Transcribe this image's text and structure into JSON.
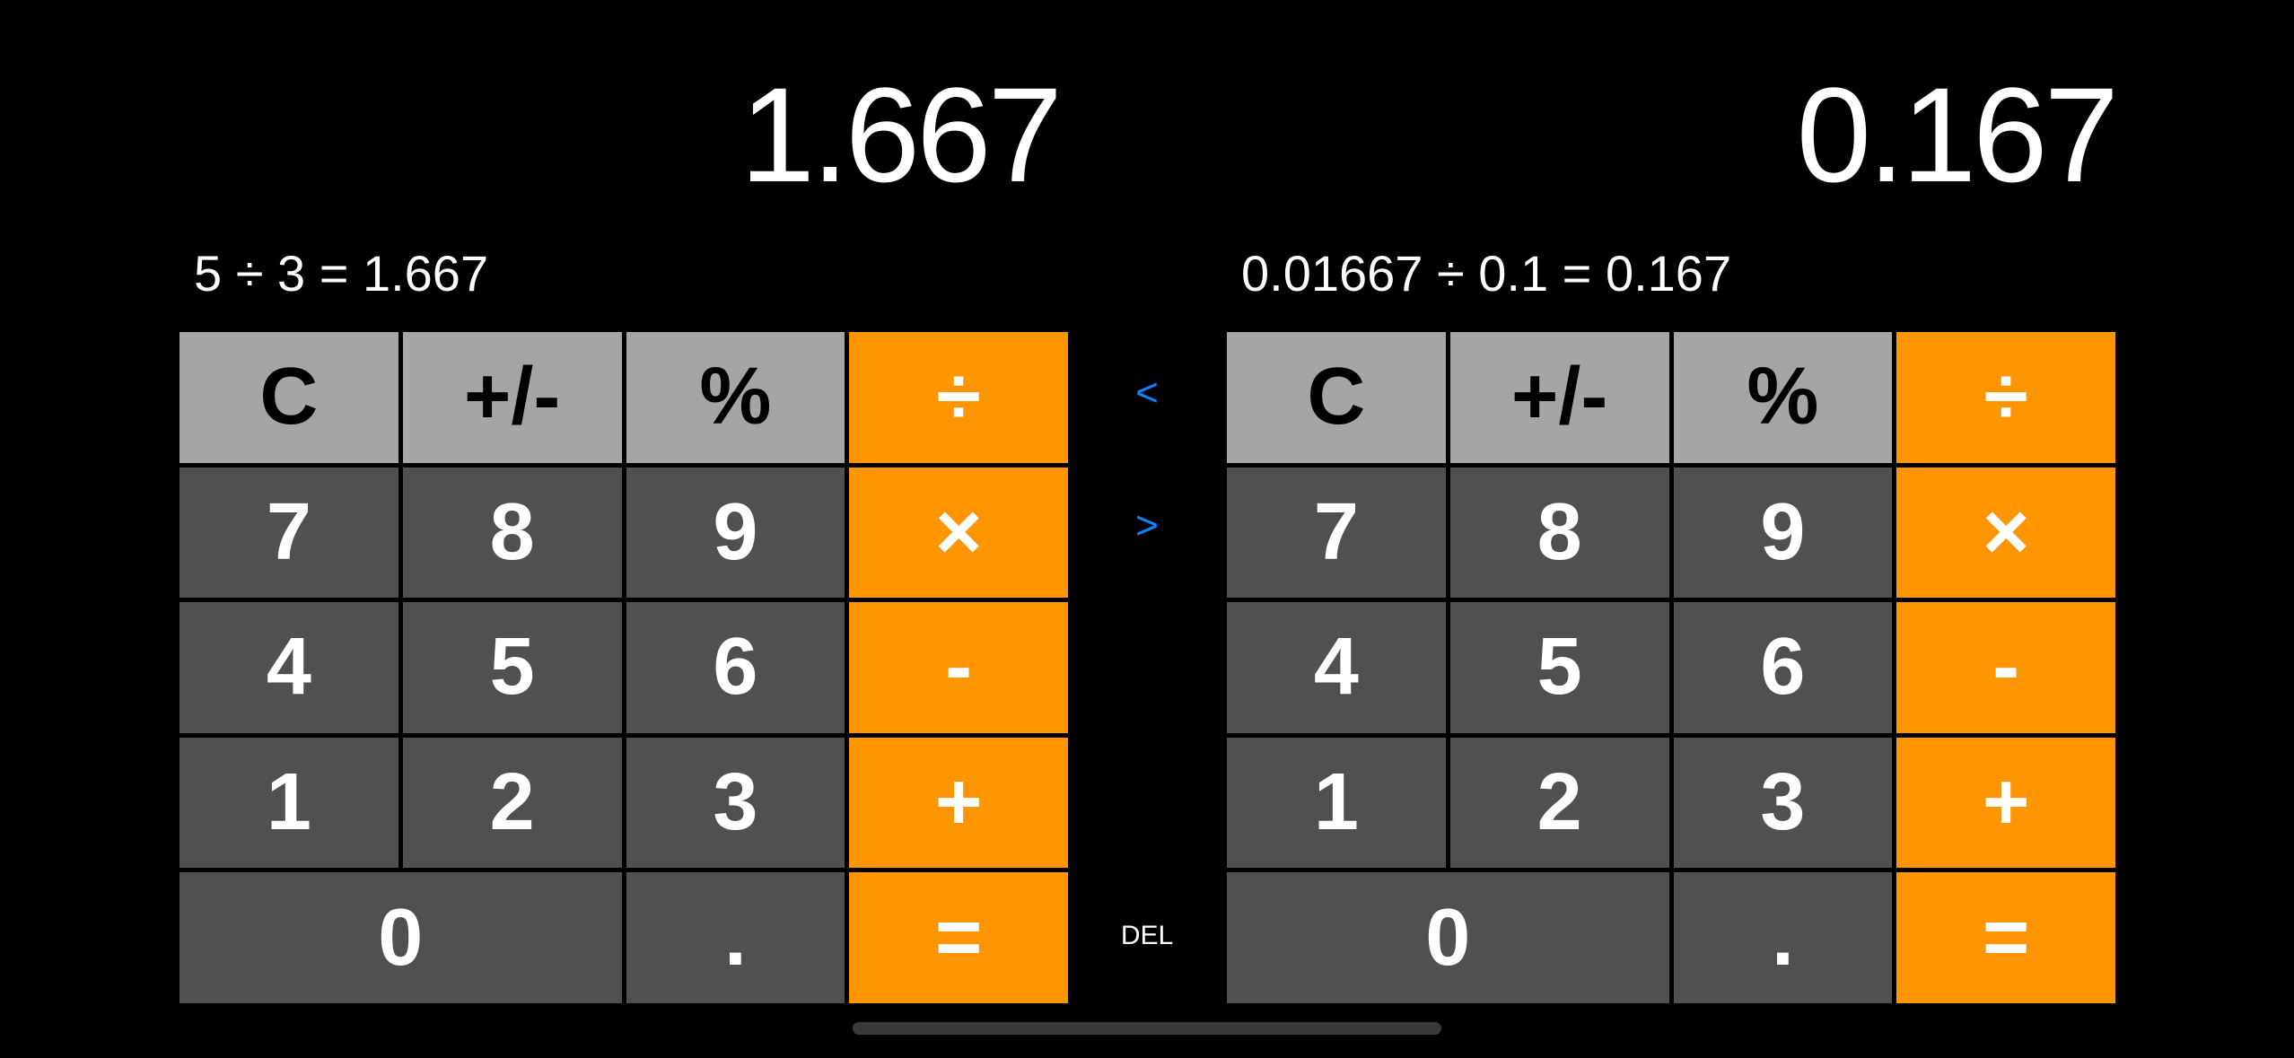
{
  "left_calc": {
    "result": "1.667",
    "expression": "5 ÷ 3 = 1.667",
    "keys": [
      "C",
      "+/-",
      "%",
      "÷",
      "7",
      "8",
      "9",
      "×",
      "4",
      "5",
      "6",
      "-",
      "1",
      "2",
      "3",
      "+",
      "0",
      ".",
      "="
    ]
  },
  "right_calc": {
    "result": "0.167",
    "expression": "0.01667 ÷ 0.1 = 0.167",
    "keys": [
      "C",
      "+/-",
      "%",
      "÷",
      "7",
      "8",
      "9",
      "×",
      "4",
      "5",
      "6",
      "-",
      "1",
      "2",
      "3",
      "+",
      "0",
      ".",
      "="
    ]
  },
  "controls": {
    "prev_label": "<",
    "next_label": ">",
    "del_label": "DEL"
  },
  "colors": {
    "function_key": "#a5a5a5",
    "number_key": "#505050",
    "operator_key": "#ff9500",
    "arrow_accent": "#0a84ff",
    "background": "#000000"
  }
}
